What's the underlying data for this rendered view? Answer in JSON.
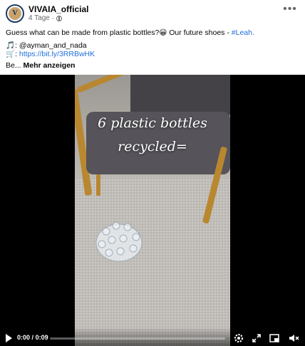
{
  "post": {
    "page_name": "VIVAIA_official",
    "timestamp": "4 Tage",
    "separator": "·",
    "avatar_initial": "V",
    "text_line1_main": "Guess what can be made from plastic bottles?",
    "text_line1_emoji": "😀",
    "text_line1_rest": " Our future shoes - ",
    "hashtag": "#Leah.",
    "credit_icon": "🎵",
    "credit_handle": ": @ayman_and_nada",
    "cart_icon": "🛒",
    "link_prefix": ":",
    "link": "https://bit.ly/3RRBwHK",
    "truncated": "Be...",
    "see_more": "Mehr anzeigen"
  },
  "video": {
    "overlay_line1": "6 plastic bottles",
    "overlay_line2": "recycled=",
    "time_current": "0:00",
    "time_total": "0:09",
    "time_separator": "/",
    "progress": 0.0
  },
  "icons": {
    "more": "more-options-icon",
    "play": "play-icon",
    "settings": "gear-icon",
    "fullscreen": "fullscreen-icon",
    "pip": "picture-in-picture-icon",
    "volume": "volume-muted-icon"
  },
  "colors": {
    "link": "#216fdb",
    "secondary_text": "#65676b",
    "video_bg": "#000000",
    "chair_gold": "#b9872f"
  }
}
